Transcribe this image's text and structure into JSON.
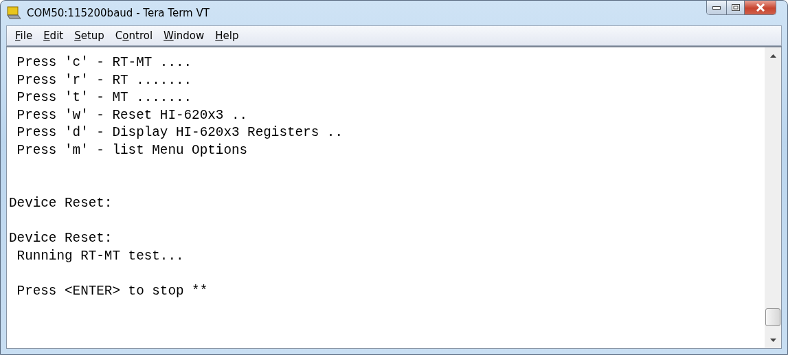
{
  "window": {
    "title": "COM50:115200baud - Tera Term VT"
  },
  "menu": [
    {
      "parts": [
        {
          "text": "F",
          "underlined": true
        },
        {
          "text": "ile",
          "underlined": false
        }
      ]
    },
    {
      "parts": [
        {
          "text": "E",
          "underlined": true
        },
        {
          "text": "dit",
          "underlined": false
        }
      ]
    },
    {
      "parts": [
        {
          "text": "S",
          "underlined": true
        },
        {
          "text": "etup",
          "underlined": false
        }
      ]
    },
    {
      "parts": [
        {
          "text": "C",
          "underlined": false
        },
        {
          "text": "o",
          "underlined": true
        },
        {
          "text": "ntrol",
          "underlined": false
        }
      ]
    },
    {
      "parts": [
        {
          "text": "W",
          "underlined": true
        },
        {
          "text": "indow",
          "underlined": false
        }
      ]
    },
    {
      "parts": [
        {
          "text": "H",
          "underlined": true
        },
        {
          "text": "elp",
          "underlined": false
        }
      ]
    }
  ],
  "terminal": {
    "lines": [
      {
        "kind": "text",
        "text": " Press 'c' - RT-MT ...."
      },
      {
        "kind": "text",
        "text": " Press 'r' - RT ......."
      },
      {
        "kind": "text",
        "text": " Press 't' - MT ......."
      },
      {
        "kind": "text",
        "text": " Press 'w' - Reset HI-620x3 .."
      },
      {
        "kind": "text",
        "text": " Press 'd' - Display HI-620x3 Registers .."
      },
      {
        "kind": "text",
        "text": " Press 'm' - list Menu Options"
      },
      {
        "kind": "blank"
      },
      {
        "kind": "blank"
      },
      {
        "kind": "text",
        "text": "Device Reset:"
      },
      {
        "kind": "blank"
      },
      {
        "kind": "text",
        "text": "Device Reset:"
      },
      {
        "kind": "text",
        "text": " Running RT-MT test..."
      },
      {
        "kind": "blank"
      },
      {
        "kind": "text",
        "text": " Press <ENTER> to stop **"
      }
    ]
  }
}
